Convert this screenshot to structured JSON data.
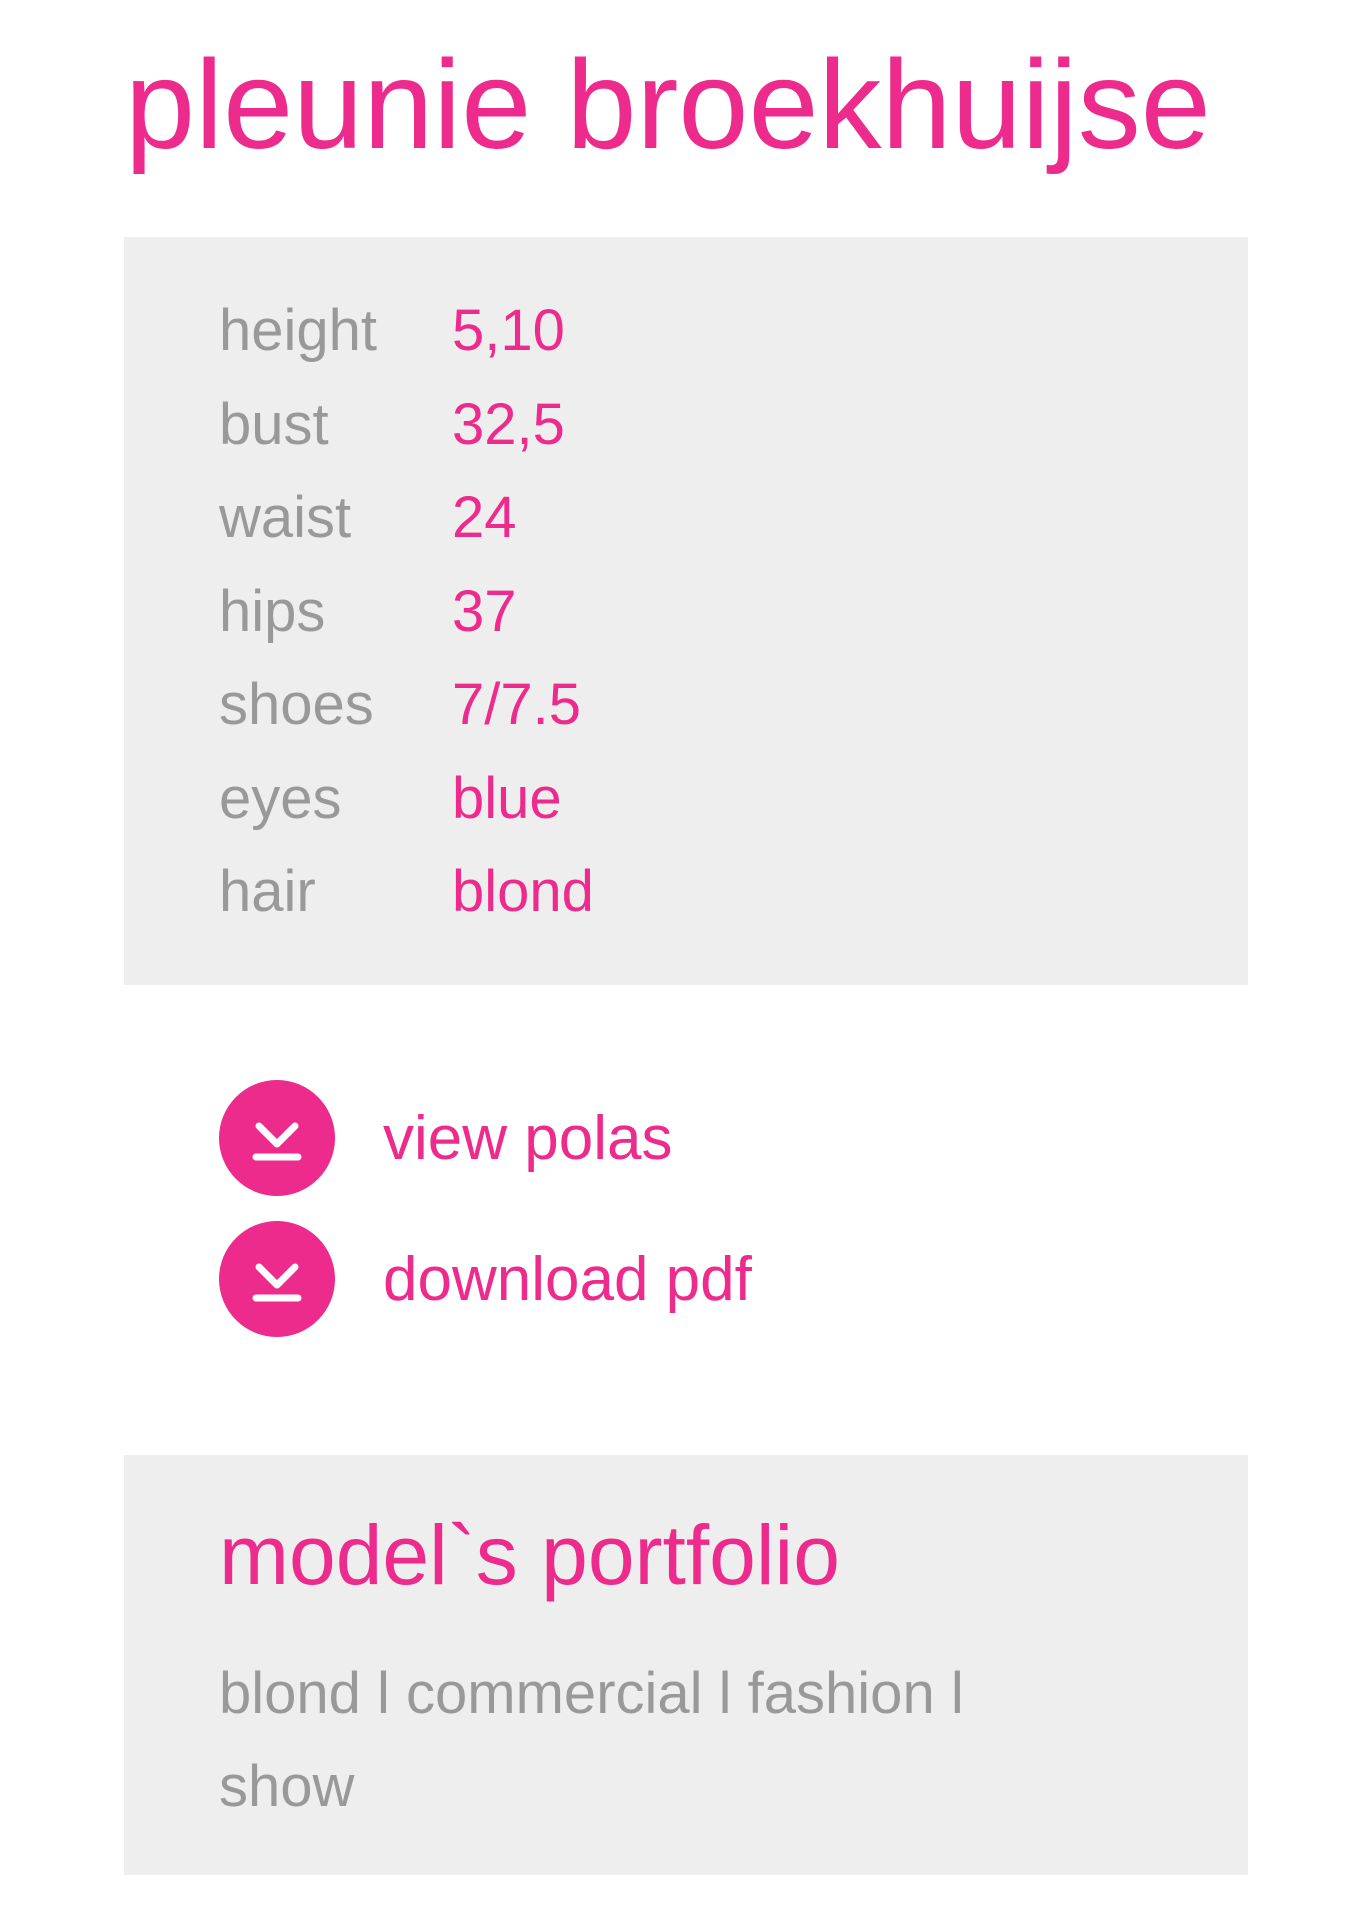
{
  "profile": {
    "name": "pleunie broekhuijse"
  },
  "stats": [
    {
      "label": "height",
      "value": "5,10"
    },
    {
      "label": "bust",
      "value": "32,5"
    },
    {
      "label": "waist",
      "value": "24"
    },
    {
      "label": "hips",
      "value": "37"
    },
    {
      "label": "shoes",
      "value": "7/7.5"
    },
    {
      "label": "eyes",
      "value": "blue"
    },
    {
      "label": "hair",
      "value": "blond"
    }
  ],
  "links": [
    {
      "label": "view polas",
      "icon": "download-icon"
    },
    {
      "label": "download pdf",
      "icon": "download-icon"
    }
  ],
  "portfolio": {
    "heading": "model`s portfolio",
    "tags": [
      "blond",
      "commercial",
      "fashion",
      "show"
    ],
    "separator": " l "
  },
  "colors": {
    "accent": "#ec2b8c",
    "muted_text": "#999999",
    "panel_bg": "#eeeeee"
  }
}
